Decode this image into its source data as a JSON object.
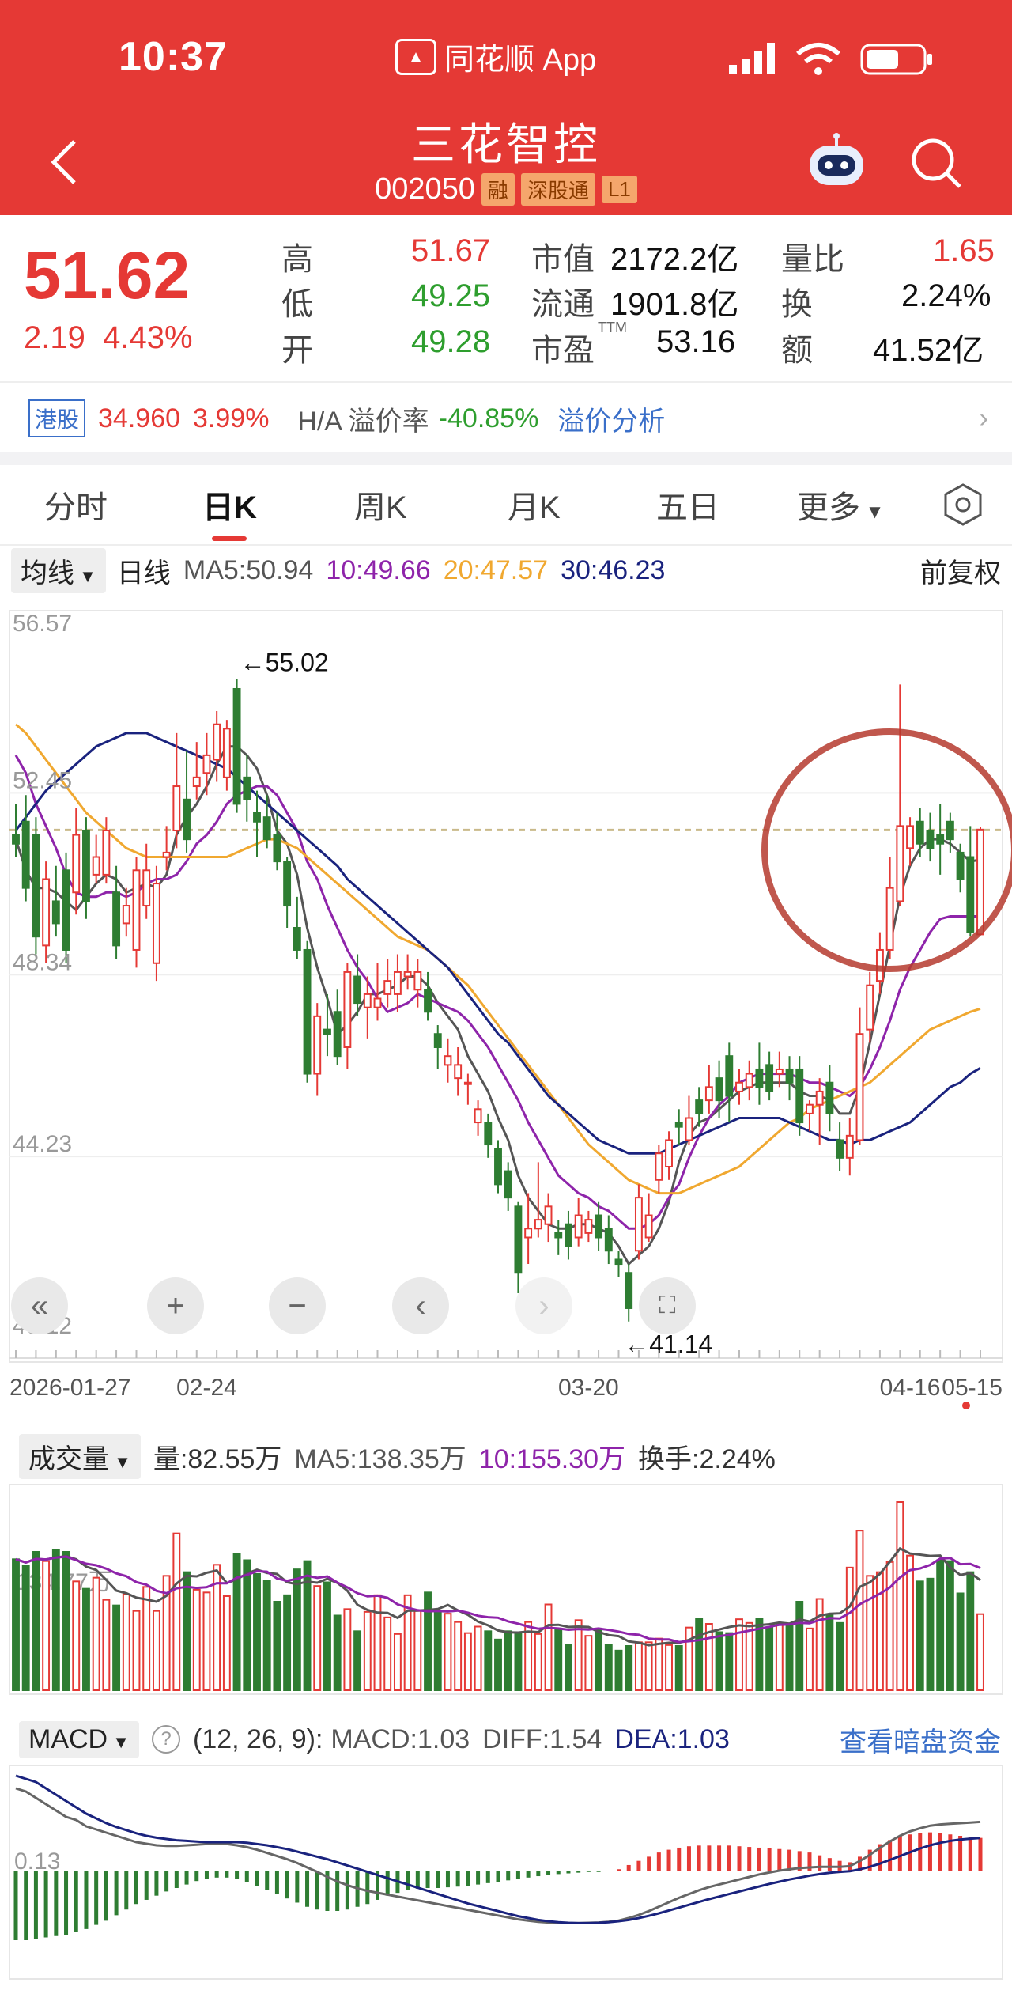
{
  "status": {
    "time": "10:37",
    "app": "同花顺 App"
  },
  "header": {
    "title": "三花智控",
    "code": "002050",
    "tags": [
      "融",
      "深股通",
      "L1"
    ]
  },
  "quote": {
    "price": "51.62",
    "change": "2.19",
    "change_pct": "4.43%",
    "high_label": "高",
    "high": "51.67",
    "low_label": "低",
    "low": "49.25",
    "open_label": "开",
    "open": "49.28",
    "mcap_label": "市值",
    "mcap": "2172.2亿",
    "float_label": "流通",
    "float": "1901.8亿",
    "pe_label": "市盈",
    "pe_sup": "TTM",
    "pe": "53.16",
    "vr_label": "量比",
    "vr": "1.65",
    "turn_label": "换",
    "turn": "2.24%",
    "amt_label": "额",
    "amt": "41.52亿"
  },
  "hk": {
    "tag": "港股",
    "price": "34.960",
    "pct": "3.99%",
    "premium_label": "H/A 溢价率",
    "premium": "-40.85%",
    "link": "溢价分析"
  },
  "tabs": [
    "分时",
    "日K",
    "周K",
    "月K",
    "五日",
    "更多"
  ],
  "active_tab": "日K",
  "ma_bar": {
    "dropdown": "均线",
    "period": "日线",
    "ma5": "MA5:50.94",
    "ma10": "10:49.66",
    "ma20": "20:47.57",
    "ma30": "30:46.23",
    "adjust": "前复权"
  },
  "vol_bar": {
    "dropdown": "成交量",
    "vol": "量:82.55万",
    "ma5": "MA5:138.35万",
    "ma10": "10:155.30万",
    "turn": "换手:2.24%"
  },
  "macd_bar": {
    "dropdown": "MACD",
    "help": "?",
    "params": "(12, 26, 9):",
    "macd": "MACD:1.03",
    "diff": "DIFF:1.54",
    "dea": "DEA:1.03",
    "link": "查看暗盘资金"
  },
  "colors": {
    "up": "#e53935",
    "down": "#2e7d32",
    "ma5": "#555555",
    "ma10": "#8e24aa",
    "ma20": "#f0a830",
    "ma30": "#1a237e"
  },
  "chart_data": {
    "type": "candlestick",
    "y_ticks": [
      "56.57",
      "52.45",
      "48.34",
      "44.23",
      "40.12"
    ],
    "ylim": [
      40.12,
      56.57
    ],
    "x_ticks": [
      "2026-01-27",
      "02-24",
      "03-20",
      "04-16",
      "05-15"
    ],
    "high_marker": "←55.02",
    "low_marker": "←41.14",
    "vol_tick": "134.77万",
    "macd_tick": "0.13",
    "candles": [
      [
        51.5,
        51.3,
        52.2,
        51.0
      ],
      [
        51.8,
        50.3,
        52.4,
        50.0
      ],
      [
        51.5,
        49.2,
        51.9,
        48.8
      ],
      [
        49.0,
        50.5,
        50.9,
        48.6
      ],
      [
        50.0,
        49.5,
        50.8,
        49.2
      ],
      [
        50.7,
        48.9,
        51.1,
        48.6
      ],
      [
        50.2,
        51.5,
        52.1,
        49.7
      ],
      [
        51.6,
        50.0,
        51.9,
        49.6
      ],
      [
        50.6,
        51.0,
        51.5,
        50.4
      ],
      [
        50.6,
        51.6,
        51.9,
        50.4
      ],
      [
        50.2,
        49.0,
        50.8,
        48.7
      ],
      [
        49.5,
        49.9,
        50.3,
        49.2
      ],
      [
        48.9,
        50.7,
        51.0,
        48.5
      ],
      [
        49.9,
        50.7,
        51.3,
        49.6
      ],
      [
        48.6,
        50.4,
        50.8,
        48.2
      ],
      [
        51.0,
        51.1,
        51.7,
        50.7
      ],
      [
        51.6,
        52.6,
        53.8,
        51.2
      ],
      [
        52.3,
        51.4,
        53.4,
        51.1
      ],
      [
        52.6,
        52.8,
        53.6,
        52.3
      ],
      [
        52.9,
        53.3,
        53.8,
        52.4
      ],
      [
        53.2,
        54.0,
        54.3,
        52.7
      ],
      [
        52.8,
        53.9,
        54.1,
        52.5
      ],
      [
        54.8,
        52.2,
        55.02,
        52.0
      ],
      [
        52.8,
        52.3,
        53.3,
        51.8
      ],
      [
        52.0,
        51.8,
        52.5,
        51.0
      ],
      [
        51.9,
        51.4,
        52.4,
        51.2
      ],
      [
        51.5,
        50.9,
        52.0,
        50.7
      ],
      [
        50.9,
        49.9,
        51.0,
        49.4
      ],
      [
        49.4,
        48.9,
        50.1,
        48.7
      ],
      [
        48.9,
        46.1,
        49.1,
        45.9
      ],
      [
        46.1,
        47.4,
        47.7,
        45.6
      ],
      [
        47.1,
        47.0,
        47.9,
        46.5
      ],
      [
        47.5,
        46.5,
        48.0,
        46.3
      ],
      [
        46.7,
        48.4,
        48.6,
        46.2
      ],
      [
        48.3,
        47.7,
        48.8,
        47.4
      ],
      [
        47.6,
        47.9,
        48.3,
        46.9
      ],
      [
        47.6,
        47.8,
        48.6,
        47.3
      ],
      [
        47.9,
        48.2,
        48.7,
        47.6
      ],
      [
        47.9,
        48.4,
        48.8,
        47.5
      ],
      [
        48.3,
        48.4,
        48.8,
        48.0
      ],
      [
        48.0,
        48.4,
        48.7,
        47.6
      ],
      [
        48.0,
        47.5,
        48.4,
        47.3
      ],
      [
        47.0,
        46.7,
        47.2,
        46.2
      ],
      [
        46.3,
        46.5,
        46.9,
        45.9
      ],
      [
        46.0,
        46.3,
        46.7,
        45.6
      ],
      [
        45.9,
        45.9,
        46.1,
        45.4
      ],
      [
        45.0,
        45.3,
        45.5,
        44.7
      ],
      [
        45.0,
        44.5,
        45.2,
        44.2
      ],
      [
        44.4,
        43.6,
        44.6,
        43.4
      ],
      [
        43.9,
        43.3,
        44.1,
        43.0
      ],
      [
        43.1,
        41.6,
        43.2,
        41.14
      ],
      [
        42.4,
        42.6,
        43.4,
        41.8
      ],
      [
        42.6,
        42.8,
        44.1,
        42.4
      ],
      [
        42.7,
        43.1,
        43.4,
        42.3
      ],
      [
        42.5,
        42.4,
        42.8,
        42.0
      ],
      [
        42.7,
        42.2,
        43.0,
        41.9
      ],
      [
        42.4,
        42.9,
        43.3,
        42.2
      ],
      [
        42.5,
        42.8,
        43.0,
        42.3
      ],
      [
        42.9,
        42.4,
        43.2,
        42.1
      ],
      [
        42.6,
        42.1,
        42.9,
        41.8
      ],
      [
        41.9,
        41.8,
        42.1,
        41.5
      ],
      [
        41.6,
        40.8,
        41.8,
        40.5
      ],
      [
        42.1,
        43.3,
        43.6,
        41.9
      ],
      [
        42.4,
        42.9,
        43.4,
        42.3
      ],
      [
        43.7,
        44.3,
        44.5,
        43.4
      ],
      [
        44.0,
        44.6,
        44.8,
        43.7
      ],
      [
        45.0,
        44.9,
        45.3,
        44.5
      ],
      [
        44.6,
        45.1,
        45.6,
        44.5
      ],
      [
        45.5,
        45.2,
        45.8,
        44.9
      ],
      [
        45.5,
        45.8,
        46.3,
        45.2
      ],
      [
        46.0,
        45.5,
        46.4,
        45.1
      ],
      [
        46.5,
        45.6,
        46.8,
        45.0
      ],
      [
        45.7,
        45.9,
        46.2,
        45.4
      ],
      [
        45.8,
        46.1,
        46.4,
        45.5
      ],
      [
        46.2,
        45.8,
        46.8,
        45.4
      ],
      [
        46.3,
        45.7,
        46.6,
        45.5
      ],
      [
        46.1,
        46.2,
        46.6,
        45.8
      ],
      [
        46.2,
        45.9,
        46.5,
        45.5
      ],
      [
        46.2,
        45.0,
        46.5,
        44.7
      ],
      [
        45.2,
        45.4,
        45.5,
        44.8
      ],
      [
        45.4,
        45.7,
        46.0,
        44.5
      ],
      [
        45.9,
        45.2,
        46.3,
        44.8
      ],
      [
        44.6,
        44.2,
        45.0,
        43.9
      ],
      [
        44.2,
        44.7,
        45.1,
        43.8
      ],
      [
        44.6,
        47.0,
        47.6,
        44.5
      ],
      [
        47.1,
        48.1,
        48.4,
        46.8
      ],
      [
        48.2,
        48.9,
        49.3,
        47.9
      ],
      [
        48.9,
        50.3,
        51.0,
        48.7
      ],
      [
        50.0,
        51.7,
        54.9,
        49.9
      ],
      [
        51.2,
        51.7,
        51.9,
        50.8
      ],
      [
        51.8,
        51.3,
        52.1,
        51.0
      ],
      [
        51.6,
        51.2,
        52.0,
        50.9
      ],
      [
        51.5,
        51.3,
        52.2,
        50.6
      ],
      [
        51.8,
        51.4,
        52.0,
        51.1
      ],
      [
        51.1,
        50.5,
        51.3,
        50.2
      ],
      [
        51.0,
        49.3,
        51.7,
        49.2
      ],
      [
        49.25,
        51.62,
        51.67,
        49.25
      ]
    ],
    "volume": [
      142,
      135,
      150,
      140,
      152,
      150,
      118,
      110,
      122,
      98,
      92,
      104,
      86,
      112,
      86,
      124,
      170,
      128,
      109,
      106,
      136,
      102,
      148,
      141,
      126,
      119,
      96,
      103,
      131,
      140,
      113,
      117,
      81,
      88,
      64,
      85,
      103,
      79,
      61,
      103,
      86,
      106,
      84,
      83,
      74,
      62,
      69,
      64,
      55,
      64,
      61,
      74,
      61,
      93,
      66,
      49,
      76,
      59,
      66,
      49,
      43,
      48,
      52,
      52,
      56,
      49,
      48,
      68,
      78,
      72,
      63,
      62,
      77,
      73,
      78,
      68,
      71,
      71,
      96,
      67,
      99,
      82,
      73,
      133,
      173,
      124,
      128,
      139,
      204,
      146,
      118,
      121,
      141,
      140,
      105,
      128,
      82.55
    ],
    "ma5": [
      51.4,
      50.7,
      50.3,
      50.3,
      50.2,
      50.0,
      49.8,
      50.1,
      50.4,
      50.6,
      50.5,
      50.2,
      50.3,
      50.4,
      50.3,
      50.6,
      51.5,
      51.9,
      52.2,
      52.6,
      53.1,
      53.5,
      53.5,
      53.3,
      53.0,
      52.4,
      51.6,
      51.3,
      50.6,
      49.4,
      48.5,
      47.8,
      47.0,
      47.2,
      47.5,
      47.9,
      47.9,
      48.0,
      48.1,
      48.3,
      48.3,
      48.1,
      47.7,
      47.4,
      47.1,
      46.5,
      46.1,
      45.7,
      45.1,
      44.6,
      43.8,
      43.3,
      43.0,
      42.7,
      42.6,
      42.6,
      42.7,
      42.7,
      42.6,
      42.5,
      42.2,
      41.8,
      42.0,
      42.2,
      42.6,
      43.2,
      44.1,
      44.7,
      45.0,
      45.1,
      45.3,
      45.5,
      45.7,
      45.8,
      45.9,
      45.9,
      45.9,
      45.9,
      45.7,
      45.6,
      45.6,
      45.5,
      45.2,
      45.2,
      45.8,
      46.8,
      47.9,
      49.0,
      50.1,
      50.8,
      51.2,
      51.4,
      51.4,
      51.3,
      51.1,
      50.9,
      50.94
    ],
    "ma10": [
      53.3,
      52.9,
      52.2,
      51.7,
      51.2,
      50.6,
      50.2,
      50.1,
      50.1,
      50.2,
      50.2,
      50.1,
      50.2,
      50.4,
      50.5,
      50.5,
      50.6,
      50.9,
      51.3,
      51.5,
      51.8,
      52.2,
      52.4,
      52.5,
      52.6,
      52.6,
      52.4,
      52.0,
      51.6,
      50.9,
      50.5,
      49.9,
      49.4,
      48.9,
      48.5,
      48.2,
      47.8,
      47.5,
      47.6,
      47.7,
      47.9,
      47.8,
      47.7,
      47.6,
      47.5,
      47.3,
      47.0,
      46.7,
      46.3,
      45.9,
      45.5,
      45.0,
      44.6,
      44.2,
      43.8,
      43.6,
      43.4,
      43.3,
      43.1,
      43.0,
      42.8,
      42.6,
      42.6,
      42.7,
      42.9,
      43.3,
      43.6,
      44.2,
      44.7,
      45.1,
      45.4,
      45.6,
      45.9,
      46.0,
      46.1,
      46.1,
      46.1,
      46.1,
      46.0,
      45.9,
      45.9,
      45.8,
      45.7,
      45.6,
      45.8,
      46.2,
      46.7,
      47.3,
      48.0,
      48.5,
      48.9,
      49.3,
      49.6,
      49.66,
      49.66,
      49.66,
      49.66
    ],
    "ma20": [
      54.0,
      53.8,
      53.5,
      53.2,
      52.9,
      52.6,
      52.3,
      52.0,
      51.8,
      51.6,
      51.4,
      51.2,
      51.1,
      51.0,
      51.0,
      51.0,
      51.0,
      51.0,
      51.0,
      51.0,
      51.0,
      51.0,
      51.1,
      51.2,
      51.3,
      51.4,
      51.4,
      51.3,
      51.2,
      51.0,
      50.8,
      50.6,
      50.4,
      50.2,
      50.0,
      49.8,
      49.6,
      49.4,
      49.2,
      49.1,
      49.0,
      48.9,
      48.7,
      48.5,
      48.3,
      48.1,
      47.8,
      47.5,
      47.2,
      46.9,
      46.6,
      46.3,
      46.0,
      45.7,
      45.4,
      45.1,
      44.8,
      44.5,
      44.3,
      44.1,
      43.9,
      43.7,
      43.6,
      43.5,
      43.4,
      43.4,
      43.4,
      43.5,
      43.6,
      43.7,
      43.8,
      43.9,
      44.0,
      44.2,
      44.4,
      44.6,
      44.8,
      45.0,
      45.1,
      45.3,
      45.4,
      45.5,
      45.6,
      45.7,
      45.8,
      45.9,
      46.1,
      46.3,
      46.5,
      46.7,
      46.9,
      47.1,
      47.2,
      47.3,
      47.4,
      47.5,
      47.57
    ],
    "ma30": [
      51.6,
      51.9,
      52.2,
      52.5,
      52.7,
      52.9,
      53.1,
      53.3,
      53.5,
      53.6,
      53.7,
      53.8,
      53.8,
      53.8,
      53.7,
      53.6,
      53.5,
      53.4,
      53.3,
      53.2,
      53.1,
      53.0,
      52.8,
      52.6,
      52.4,
      52.2,
      52.0,
      51.8,
      51.6,
      51.4,
      51.2,
      51.0,
      50.8,
      50.5,
      50.3,
      50.1,
      49.9,
      49.7,
      49.5,
      49.3,
      49.1,
      48.9,
      48.7,
      48.5,
      48.2,
      47.9,
      47.6,
      47.3,
      47.0,
      46.8,
      46.5,
      46.2,
      45.9,
      45.6,
      45.4,
      45.2,
      45.0,
      44.8,
      44.6,
      44.5,
      44.4,
      44.3,
      44.3,
      44.3,
      44.3,
      44.4,
      44.5,
      44.6,
      44.7,
      44.8,
      44.9,
      45.0,
      45.1,
      45.1,
      45.1,
      45.1,
      45.1,
      45.0,
      44.9,
      44.8,
      44.7,
      44.6,
      44.6,
      44.5,
      44.6,
      44.6,
      44.7,
      44.8,
      44.9,
      45.0,
      45.2,
      45.4,
      45.6,
      45.8,
      45.9,
      46.1,
      46.23
    ],
    "macd_hist": [
      -1.0,
      -1.0,
      -0.98,
      -0.96,
      -0.94,
      -0.92,
      -0.88,
      -0.84,
      -0.78,
      -0.72,
      -0.64,
      -0.56,
      -0.48,
      -0.42,
      -0.36,
      -0.3,
      -0.25,
      -0.2,
      -0.15,
      -0.12,
      -0.1,
      -0.1,
      -0.12,
      -0.16,
      -0.22,
      -0.28,
      -0.34,
      -0.4,
      -0.46,
      -0.52,
      -0.56,
      -0.58,
      -0.58,
      -0.56,
      -0.52,
      -0.48,
      -0.42,
      -0.36,
      -0.32,
      -0.28,
      -0.26,
      -0.25,
      -0.25,
      -0.24,
      -0.23,
      -0.22,
      -0.2,
      -0.18,
      -0.16,
      -0.14,
      -0.12,
      -0.1,
      -0.08,
      -0.06,
      -0.05,
      -0.04,
      -0.03,
      -0.02,
      -0.02,
      -0.01,
      0.02,
      0.08,
      0.14,
      0.2,
      0.26,
      0.3,
      0.33,
      0.35,
      0.36,
      0.36,
      0.36,
      0.36,
      0.35,
      0.34,
      0.33,
      0.32,
      0.31,
      0.3,
      0.28,
      0.26,
      0.22,
      0.18,
      0.14,
      0.12,
      0.2,
      0.3,
      0.38,
      0.44,
      0.5,
      0.52,
      0.54,
      0.55,
      0.54,
      0.52,
      0.5,
      0.48,
      0.47
    ],
    "diff": [
      2.6,
      2.5,
      2.3,
      2.1,
      1.9,
      1.7,
      1.6,
      1.4,
      1.3,
      1.2,
      1.1,
      1.0,
      0.9,
      0.85,
      0.8,
      0.78,
      0.78,
      0.8,
      0.82,
      0.84,
      0.85,
      0.84,
      0.8,
      0.74,
      0.66,
      0.56,
      0.46,
      0.36,
      0.24,
      0.1,
      -0.04,
      -0.2,
      -0.34,
      -0.46,
      -0.56,
      -0.64,
      -0.7,
      -0.76,
      -0.82,
      -0.88,
      -0.94,
      -1.0,
      -1.06,
      -1.12,
      -1.18,
      -1.24,
      -1.3,
      -1.36,
      -1.42,
      -1.48,
      -1.54,
      -1.58,
      -1.62,
      -1.64,
      -1.65,
      -1.66,
      -1.66,
      -1.65,
      -1.64,
      -1.62,
      -1.58,
      -1.5,
      -1.4,
      -1.28,
      -1.14,
      -1.0,
      -0.86,
      -0.74,
      -0.62,
      -0.52,
      -0.44,
      -0.36,
      -0.28,
      -0.2,
      -0.12,
      -0.06,
      0.0,
      0.04,
      0.08,
      0.1,
      0.12,
      0.12,
      0.12,
      0.14,
      0.3,
      0.5,
      0.72,
      0.92,
      1.1,
      1.24,
      1.34,
      1.42,
      1.46,
      1.48,
      1.5,
      1.52,
      1.54
    ],
    "dea": [
      3.0,
      2.9,
      2.8,
      2.6,
      2.4,
      2.2,
      2.0,
      1.8,
      1.65,
      1.5,
      1.38,
      1.28,
      1.18,
      1.1,
      1.04,
      1.0,
      0.96,
      0.94,
      0.92,
      0.9,
      0.9,
      0.9,
      0.9,
      0.88,
      0.84,
      0.8,
      0.74,
      0.68,
      0.6,
      0.52,
      0.44,
      0.36,
      0.26,
      0.16,
      0.06,
      -0.04,
      -0.14,
      -0.24,
      -0.34,
      -0.44,
      -0.54,
      -0.64,
      -0.74,
      -0.84,
      -0.94,
      -1.04,
      -1.12,
      -1.2,
      -1.28,
      -1.36,
      -1.44,
      -1.5,
      -1.56,
      -1.6,
      -1.63,
      -1.65,
      -1.66,
      -1.66,
      -1.65,
      -1.63,
      -1.6,
      -1.56,
      -1.5,
      -1.43,
      -1.35,
      -1.26,
      -1.17,
      -1.08,
      -0.99,
      -0.9,
      -0.82,
      -0.74,
      -0.66,
      -0.58,
      -0.5,
      -0.42,
      -0.35,
      -0.28,
      -0.22,
      -0.16,
      -0.11,
      -0.07,
      -0.04,
      -0.02,
      0.04,
      0.12,
      0.22,
      0.34,
      0.46,
      0.58,
      0.7,
      0.8,
      0.88,
      0.94,
      0.98,
      1.01,
      1.03
    ]
  }
}
